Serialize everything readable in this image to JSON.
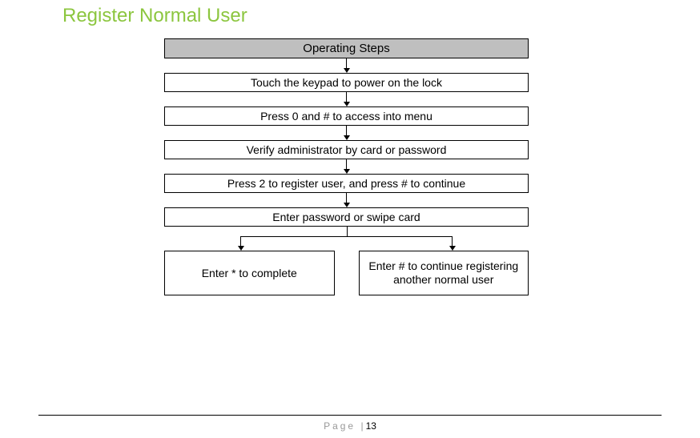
{
  "title": "Register Normal User",
  "header": "Operating Steps",
  "steps": [
    "Touch the keypad to power on the lock",
    "Press  0 and  # to access into menu",
    "Verify administrator by card or password",
    "Press 2 to register user, and press # to continue",
    "Enter password or swipe card"
  ],
  "split_left": "Enter * to complete",
  "split_right": "Enter # to continue registering another normal user",
  "footer_label": "Page |",
  "footer_num": "13"
}
